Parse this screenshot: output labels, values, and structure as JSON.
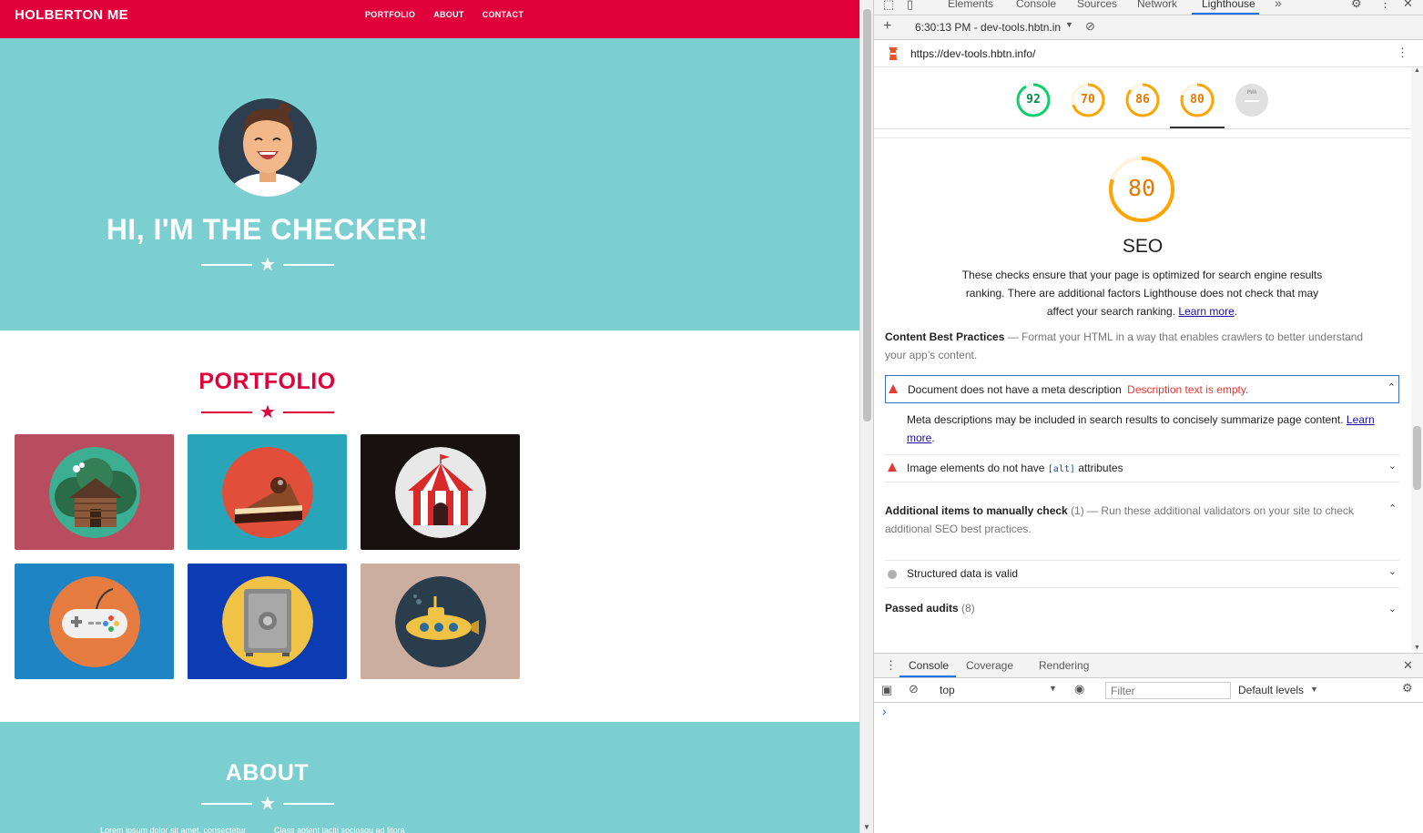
{
  "site": {
    "brand": "HOLBERTON ME",
    "nav": [
      "PORTFOLIO",
      "ABOUT",
      "CONTACT"
    ],
    "hero_title": "HI, I'M THE CHECKER!",
    "portfolio_title": "PORTFOLIO",
    "about_title": "ABOUT",
    "about_text_left": "Lorem ipsum dolor sit amet, consectetur",
    "about_text_right": "Class aptent taciti sociosqu ad litora",
    "colors": {
      "accent": "#e0003c",
      "teal": "#7bcfd1"
    },
    "tiles": [
      {
        "name": "cabin",
        "bg": "#b94d60",
        "disc": "#3cae92"
      },
      {
        "name": "cake",
        "bg": "#28a5b8",
        "disc": "#e14f3a"
      },
      {
        "name": "circus-tent",
        "bg": "#171111",
        "disc": "#e8e8e8"
      },
      {
        "name": "game-controller",
        "bg": "#1e84c4",
        "disc": "#e67c3f"
      },
      {
        "name": "safe",
        "bg": "#0b3cb3",
        "disc": "#f0c246"
      },
      {
        "name": "submarine",
        "bg": "#cbaea0",
        "disc": "#2a3d4d"
      }
    ]
  },
  "devtools": {
    "tabs": [
      "Elements",
      "Console",
      "Sources",
      "Network",
      "Lighthouse"
    ],
    "active_tab": "Lighthouse",
    "more_tabs": "»",
    "report_selector": "6:30:13 PM - dev-tools.hbtn.in",
    "url": "https://dev-tools.hbtn.info/",
    "gauges": [
      {
        "label": "92",
        "score": 92,
        "color": "#0cce6b"
      },
      {
        "label": "70",
        "score": 70,
        "color": "#ffa400"
      },
      {
        "label": "86",
        "score": 86,
        "color": "#ffa400"
      },
      {
        "label": "80",
        "score": 80,
        "color": "#ffa400"
      },
      {
        "label": "PWA",
        "score": 0,
        "color": "#bdbdbd"
      }
    ],
    "seo": {
      "score": "80",
      "title": "SEO",
      "desc": "These checks ensure that your page is optimized for search engine results ranking. There are additional factors Lighthouse does not check that may affect your search ranking.",
      "learn_more": "Learn more",
      "content_group_title": "Content Best Practices",
      "content_group_desc": "Format your HTML in a way that enables crawlers to better understand your app’s content.",
      "audit_meta_title": "Document does not have a meta description",
      "audit_meta_error": "Description text is empty.",
      "audit_meta_desc": "Meta descriptions may be included in search results to concisely summarize page content.",
      "learn_more_2": "Learn more",
      "audit_alt_before": "Image elements do not have",
      "audit_alt_code": "[alt]",
      "audit_alt_after": "attributes",
      "manual_title": "Additional items to manually check",
      "manual_count": "(1)",
      "manual_desc": "Run these additional validators on your site to check additional SEO best practices.",
      "structured": "Structured data is valid",
      "passed_title": "Passed audits",
      "passed_count": "(8)"
    },
    "drawer_tabs": [
      "Console",
      "Coverage",
      "Rendering"
    ],
    "context": "top",
    "filter_placeholder": "Filter",
    "levels": "Default levels",
    "prompt": "›"
  }
}
